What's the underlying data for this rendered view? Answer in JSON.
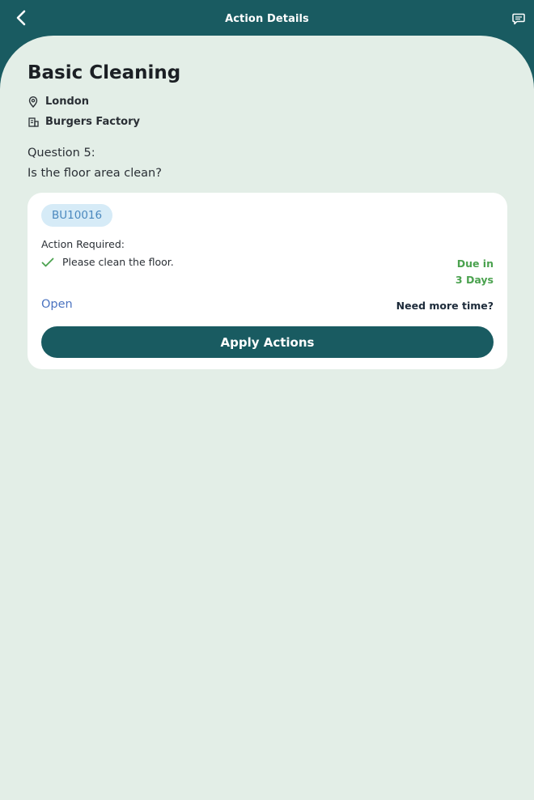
{
  "header": {
    "title": "Action Details",
    "back_icon": "chevron-left-icon",
    "chat_icon": "chat-bubble-icon"
  },
  "task": {
    "title": "Basic Cleaning",
    "location": "London",
    "site": "Burgers Factory"
  },
  "question": {
    "number": "Question 5:",
    "text": "Is the floor area clean?"
  },
  "action_card": {
    "id_badge": "BU10016",
    "action_required_label": "Action Required:",
    "action_item": "Please clean the floor.",
    "due_line1": "Due in",
    "due_line2": "3 Days",
    "status": "Open",
    "more_time": "Need more time?",
    "apply_label": "Apply Actions"
  },
  "colors": {
    "header_bg": "#195b61",
    "sheet_bg": "#e3eee7",
    "due_green": "#4ba24f",
    "status_blue": "#4b73c0",
    "badge_bg": "#d6ebf7",
    "badge_text": "#4a88be"
  }
}
